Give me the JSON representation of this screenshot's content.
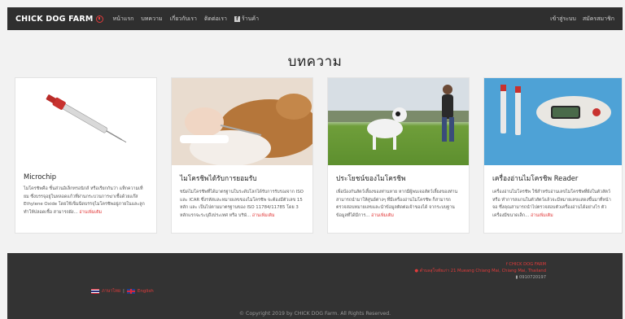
{
  "navbar": {
    "brand": "CHICK DOG FARM",
    "links": [
      "หน้าแรก",
      "บทความ",
      "เกี่ยวกับเรา",
      "ติดต่อเรา",
      "ร้านค้า"
    ],
    "login": "เข้าสู่ระบบ",
    "register": "สมัครสมาชิก"
  },
  "page": {
    "title": "บทความ"
  },
  "cards": [
    {
      "title": "Microchip",
      "text": "ไมโครชิพคือ ชิ้นส่วนอิเล็กทรอนิกส์ หรือเรียกกันว่า แท็กความเที่ยม ซึ่งบรรจุอยู่ในหลอดแก้วที่ผ่านกระบวนการฆ่าเชื้อด้วยแก๊ส Ethylene Oxide โดยใช้เข็มฉีดบรรจุไมโครชิพอยู่ภายในและลูกทำให้ปลอดเชื้อ สามารถฝัง...",
      "read_more": "อ่านเพิ่มเติม"
    },
    {
      "title": "ไมโครชิพได้รับการยอมรับ",
      "text": "ชนิดไมโครชิพที่ได้มาตรฐานในระดับโลกได้รับการรับรองจาก ISO และ ICAR ซึ่งรหัสและหมายเลขของไมโครชิพ จะต้องมีตัวเลข 15 หลัก และ เป็นไปตามมาตรฐานของ ISO 11784/11785 โดย 3 หลักแรกจะระบุถึงประเทศ หรือ บริษั...",
      "read_more": "อ่านเพิ่มเติม"
    },
    {
      "title": "ประโยชน์ของไมโครชิพ",
      "text": "เพื่อป้องกันสัตว์เลี้ยงของท่านหาย หากมีผู้พบเจอสัตว์เลี้ยงของท่านสามารถนำมาให้ศูนย์ต่างๆ ที่มีเครื่องอ่านไมโครชิพ ก็สามารถตรวจสอบหมายเลขและนำข้อมูลติดต่อเจ้าของได้ จากระบบฐานข้อมูลที่ได้มีการ...",
      "read_more": "อ่านเพิ่มเติม"
    },
    {
      "title": "เครื่องอ่านไมโครชิพ Reader",
      "text": "เครื่องอ่านไมโครชิพ ใช้สำหรับอ่านเลขไมโครชิพที่ฝังในตัวสัตว์ หรือ ทำการสแกนในตัวสัตว์แล้วจะมีหมายเลขแสดงขึ้นมาที่หน้าจอ ซึ่งคุณสามารถนำไปตรวจสอบตัวเครื่องอ่านได้อย่างไร ตัวเครื่องมีขนาดเล็ก...",
      "read_more": "อ่านเพิ่มเติม"
    }
  ],
  "footer": {
    "facebook": "CHICK DOG FARM",
    "address": "ตำบลสุโขทัยเก่า 21 Mueang Chiang Mai, Chiang Mai, Thailand",
    "phone": "0910720197",
    "lang_th": "ภาษาไทย",
    "lang_en": "English",
    "separator": "|",
    "copyright": "© Copyright 2019 by CHICK DOG Farm. All Rights Reserved."
  }
}
